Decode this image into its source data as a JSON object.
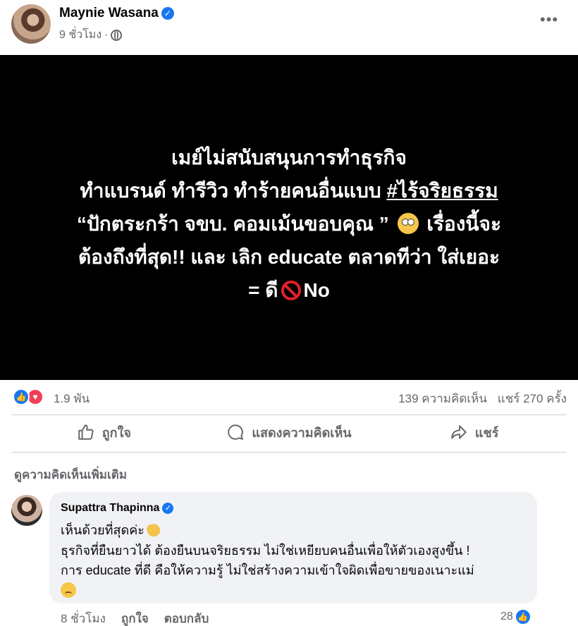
{
  "post": {
    "author": "Maynie Wasana",
    "time": "9 ชั่วโมง",
    "meta_sep": "·",
    "more": "•••",
    "image_lines": {
      "line1": "เมย์ไม่สนับสนุนการทำธุรกิจ",
      "line2_pre": "ทำแบรนด์ ทำรีวิว ทำร้ายคนอื่นแบบ ",
      "line2_hashtag": "#ไร้จริยธรรม",
      "line3_pre": "“ปักตระกร้า จขบ. คอมเม้นขอบคุณ ”",
      "line3_post": "เรื่องนี้จะ",
      "line4": "ต้องถึงที่สุด!! และ เลิก educate ตลาดทีว่า ใส่เยอะ",
      "line5_pre": "= ดี",
      "line5_post": "No"
    }
  },
  "reactions": {
    "like_glyph": "👍",
    "love_glyph": "♥",
    "count": "1.9 พัน",
    "comments": "139 ความคิดเห็น",
    "shares": "แชร์ 270 ครั้ง"
  },
  "actions": {
    "like": "ถูกใจ",
    "comment": "แสดงความคิดเห็น",
    "share": "แชร์"
  },
  "more_comments": "ดูความคิดเห็นเพิ่มเติม",
  "comment": {
    "author": "Supattra Thapinna",
    "line1": "เห็นด้วยที่สุดค่ะ",
    "line2": "ธุรกิจที่ยืนยาวได้ ต้องยืนบนจริยธรรม ไม่ใช่เหยียบคนอื่นเพื่อให้ตัวเองสูงขึ้น !",
    "line3": "การ educate ที่ดี คือให้ความรู้ ไม่ใช่สร้างความเข้าใจผิดเพื่อขายของเนาะแม่",
    "time": "8 ชั่วโมง",
    "like": "ถูกใจ",
    "reply": "ตอบกลับ",
    "like_count": "28"
  },
  "colors": {
    "accent": "#1877f2",
    "love": "#f33e58",
    "muted": "#65676b",
    "image_bg": "#000000"
  },
  "icons": [
    "verified-icon",
    "globe-icon",
    "more-icon",
    "like-icon",
    "comment-icon",
    "share-icon",
    "face-rolling-eyes-icon",
    "prohibited-icon",
    "clap-icon",
    "pensive-face-icon"
  ]
}
